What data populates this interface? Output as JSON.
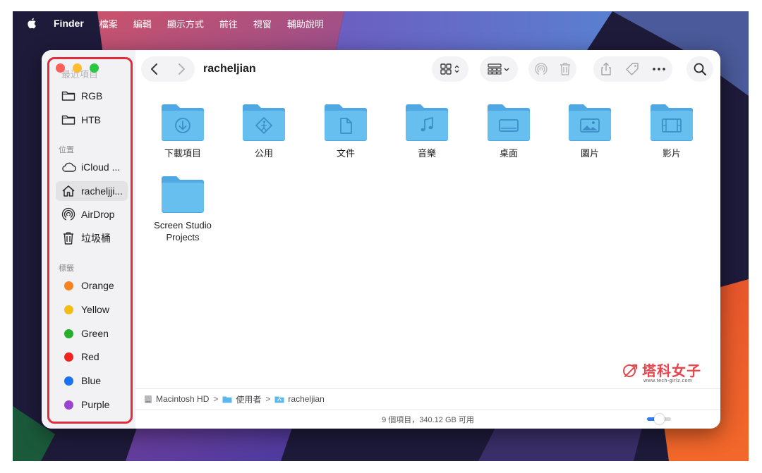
{
  "menubar": {
    "app": "Finder",
    "items": [
      "檔案",
      "編輯",
      "顯示方式",
      "前往",
      "視窗",
      "輔助說明"
    ]
  },
  "window": {
    "title": "racheljian"
  },
  "sidebar": {
    "ghost_label": "最近項目",
    "top_items": [
      {
        "label": "RGB",
        "icon": "folder-icon"
      },
      {
        "label": "HTB",
        "icon": "folder-icon"
      }
    ],
    "locations_header": "位置",
    "locations": [
      {
        "label": "iCloud ...",
        "icon": "cloud-icon"
      },
      {
        "label": "racheljji...",
        "icon": "home-icon",
        "selected": true
      },
      {
        "label": "AirDrop",
        "icon": "airdrop-icon"
      },
      {
        "label": "垃圾桶",
        "icon": "trash-icon"
      }
    ],
    "tags_header": "標籤",
    "tags": [
      {
        "label": "Orange",
        "color": "#f5831f"
      },
      {
        "label": "Yellow",
        "color": "#f4bd16"
      },
      {
        "label": "Green",
        "color": "#27ae2a"
      },
      {
        "label": "Red",
        "color": "#f0231f"
      },
      {
        "label": "Blue",
        "color": "#1b72f0"
      },
      {
        "label": "Purple",
        "color": "#9b43cf"
      }
    ]
  },
  "folders": [
    {
      "name": "下載項目",
      "glyph": "download-icon"
    },
    {
      "name": "公用",
      "glyph": "public-icon"
    },
    {
      "name": "文件",
      "glyph": "document-icon"
    },
    {
      "name": "音樂",
      "glyph": "music-icon"
    },
    {
      "name": "桌面",
      "glyph": "desktop-icon"
    },
    {
      "name": "圖片",
      "glyph": "pictures-icon"
    },
    {
      "name": "影片",
      "glyph": "movies-icon"
    },
    {
      "name": "Screen Studio Projects",
      "glyph": "folder-icon"
    }
  ],
  "pathbar": {
    "segments": [
      "Macintosh HD",
      "使用者",
      "racheljian"
    ],
    "separator": ">"
  },
  "status": {
    "text": "9 個項目，340.12 GB 可用",
    "zoom_fraction": 0.5
  },
  "watermark": {
    "text": "塔科女子",
    "url": "www.tech-girlz.com"
  },
  "colors": {
    "accent": "#2f7cf6",
    "folder": "#5ab8ee",
    "highlight_box": "#e02d3c"
  }
}
